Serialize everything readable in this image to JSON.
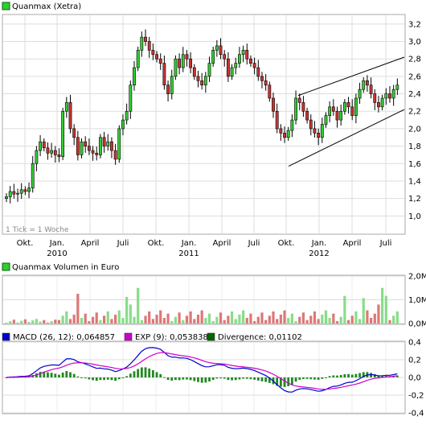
{
  "chart_data": [
    {
      "type": "candlestick",
      "title": "Quanmax (Xetra)",
      "legend_color": "#33cc33",
      "note": "1 Tick = 1 Woche",
      "y_ticks": [
        "3,2",
        "3,0",
        "2,8",
        "2,6",
        "2,4",
        "2,2",
        "2,0",
        "1,8",
        "1,6",
        "1,4",
        "1,2",
        "1,0"
      ],
      "ylim": [
        0.8,
        3.3
      ],
      "x_ticks": [
        "Okt.",
        "Jan.",
        "April",
        "Juli",
        "Okt.",
        "Jan.",
        "April",
        "Juli",
        "Okt.",
        "Jan.",
        "April",
        "Juli"
      ],
      "x_years": [
        "2010",
        "2011",
        "2012"
      ],
      "up_color": "#33cc33",
      "down_color": "#cc3333",
      "close_series": [
        1.22,
        1.28,
        1.25,
        1.26,
        1.3,
        1.28,
        1.32,
        1.6,
        1.75,
        1.85,
        1.78,
        1.72,
        1.75,
        1.7,
        1.68,
        2.2,
        2.3,
        2.0,
        1.9,
        1.7,
        1.85,
        1.8,
        1.75,
        1.72,
        1.7,
        1.9,
        1.8,
        1.85,
        1.75,
        1.65,
        2.0,
        2.1,
        2.2,
        2.5,
        2.7,
        2.9,
        3.05,
        3.0,
        2.9,
        2.85,
        2.8,
        2.75,
        2.5,
        2.4,
        2.6,
        2.8,
        2.7,
        2.85,
        2.8,
        2.7,
        2.6,
        2.55,
        2.5,
        2.6,
        2.75,
        2.9,
        2.95,
        2.85,
        2.8,
        2.6,
        2.7,
        2.75,
        2.85,
        2.9,
        2.8,
        2.75,
        2.7,
        2.6,
        2.55,
        2.5,
        2.35,
        2.2,
        2.0,
        1.95,
        1.9,
        1.98,
        2.1,
        2.35,
        2.3,
        2.2,
        2.1,
        2.0,
        1.95,
        1.9,
        2.05,
        2.15,
        2.25,
        2.2,
        2.1,
        2.2,
        2.3,
        2.25,
        2.15,
        2.35,
        2.45,
        2.55,
        2.5,
        2.4,
        2.3,
        2.25,
        2.35,
        2.4,
        2.35,
        2.45,
        2.5
      ],
      "channel_upper": {
        "from": [
          "Okt.",
          2.38
        ],
        "to": [
          "end",
          2.82
        ]
      },
      "channel_lower": {
        "from": [
          "Okt.",
          1.57
        ],
        "to": [
          "end",
          2.22
        ]
      }
    },
    {
      "type": "bar",
      "title": "Quanmax Volumen in Euro",
      "legend_color": "#33cc33",
      "y_ticks": [
        "2,0M",
        "1,0M",
        "0,0M"
      ],
      "ylim": [
        0,
        2.0
      ],
      "unit": "M EUR"
    },
    {
      "type": "line",
      "legend": [
        {
          "label": "MACD (26, 12): 0,064857",
          "color": "#0000cc"
        },
        {
          "label": "EXP (9): 0,053838",
          "color": "#cc00cc"
        },
        {
          "label": "Divergence: 0,01102",
          "color": "#006600"
        }
      ],
      "y_ticks": [
        "0,4",
        "0,2",
        "0,0",
        "-0,2",
        "-0,4"
      ],
      "ylim": [
        -0.4,
        0.4
      ]
    }
  ]
}
